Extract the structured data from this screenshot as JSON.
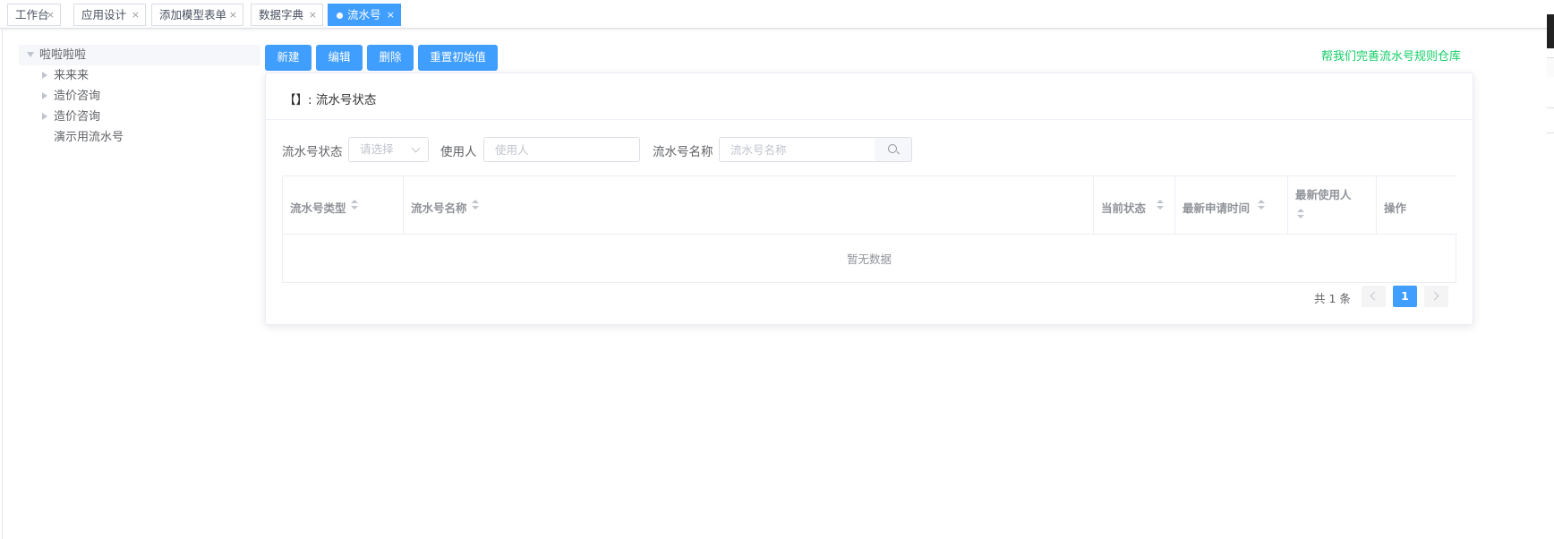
{
  "tabs": [
    {
      "label": "工作台",
      "close": "×"
    },
    {
      "label": "应用设计",
      "close": "×"
    },
    {
      "label": "添加模型表单",
      "close": "×"
    },
    {
      "label": "数据字典",
      "close": "×"
    },
    {
      "label": "流水号",
      "close": "×",
      "active": true
    }
  ],
  "tree": {
    "root": "啦啦啦啦",
    "children": [
      "来来来",
      "造价咨询",
      "造价咨询",
      "演示用流水号"
    ]
  },
  "toolbar": {
    "new": "新建",
    "edit": "编辑",
    "delete": "删除",
    "reset": "重置初始值"
  },
  "help_link": "帮我们完善流水号规则仓库",
  "card": {
    "title": "【】: 流水号状态"
  },
  "filters": {
    "status_label": "流水号状态",
    "status_placeholder": "请选择",
    "user_label": "使用人",
    "user_placeholder": "使用人",
    "name_label": "流水号名称",
    "name_placeholder": "流水号名称"
  },
  "table": {
    "columns": [
      "流水号类型",
      "流水号名称",
      "当前状态",
      "最新申请时间",
      "最新使用人",
      "操作"
    ],
    "empty_text": "暂无数据"
  },
  "pagination": {
    "total": "共 1 条",
    "current_page": "1"
  },
  "colors": {
    "primary": "#409eff",
    "link_green": "#13ce66"
  }
}
